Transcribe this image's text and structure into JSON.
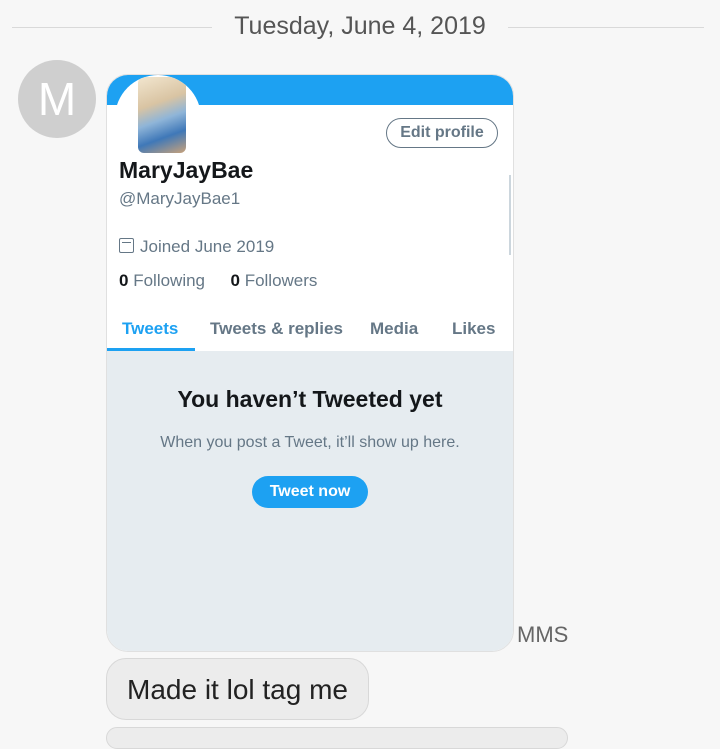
{
  "date_separator": "Tuesday, June 4, 2019",
  "sender_avatar_letter": "M",
  "profile": {
    "edit_button": "Edit profile",
    "name": "MaryJayBae",
    "handle": "@MaryJayBae1",
    "joined": "Joined June 2019",
    "following_count": "0",
    "following_label": "Following",
    "followers_count": "0",
    "followers_label": "Followers",
    "tabs": [
      "Tweets",
      "Tweets & replies",
      "Media",
      "Likes"
    ],
    "active_tab": "Tweets",
    "empty_title": "You haven’t Tweeted yet",
    "empty_subtitle": "When you post a Tweet, it’ll show up here.",
    "tweet_now_button": "Tweet now",
    "accent_color": "#1da1f2"
  },
  "mms_label": "MMS",
  "message_text": "Made it lol tag me",
  "icons": {
    "calendar": "calendar-icon"
  }
}
